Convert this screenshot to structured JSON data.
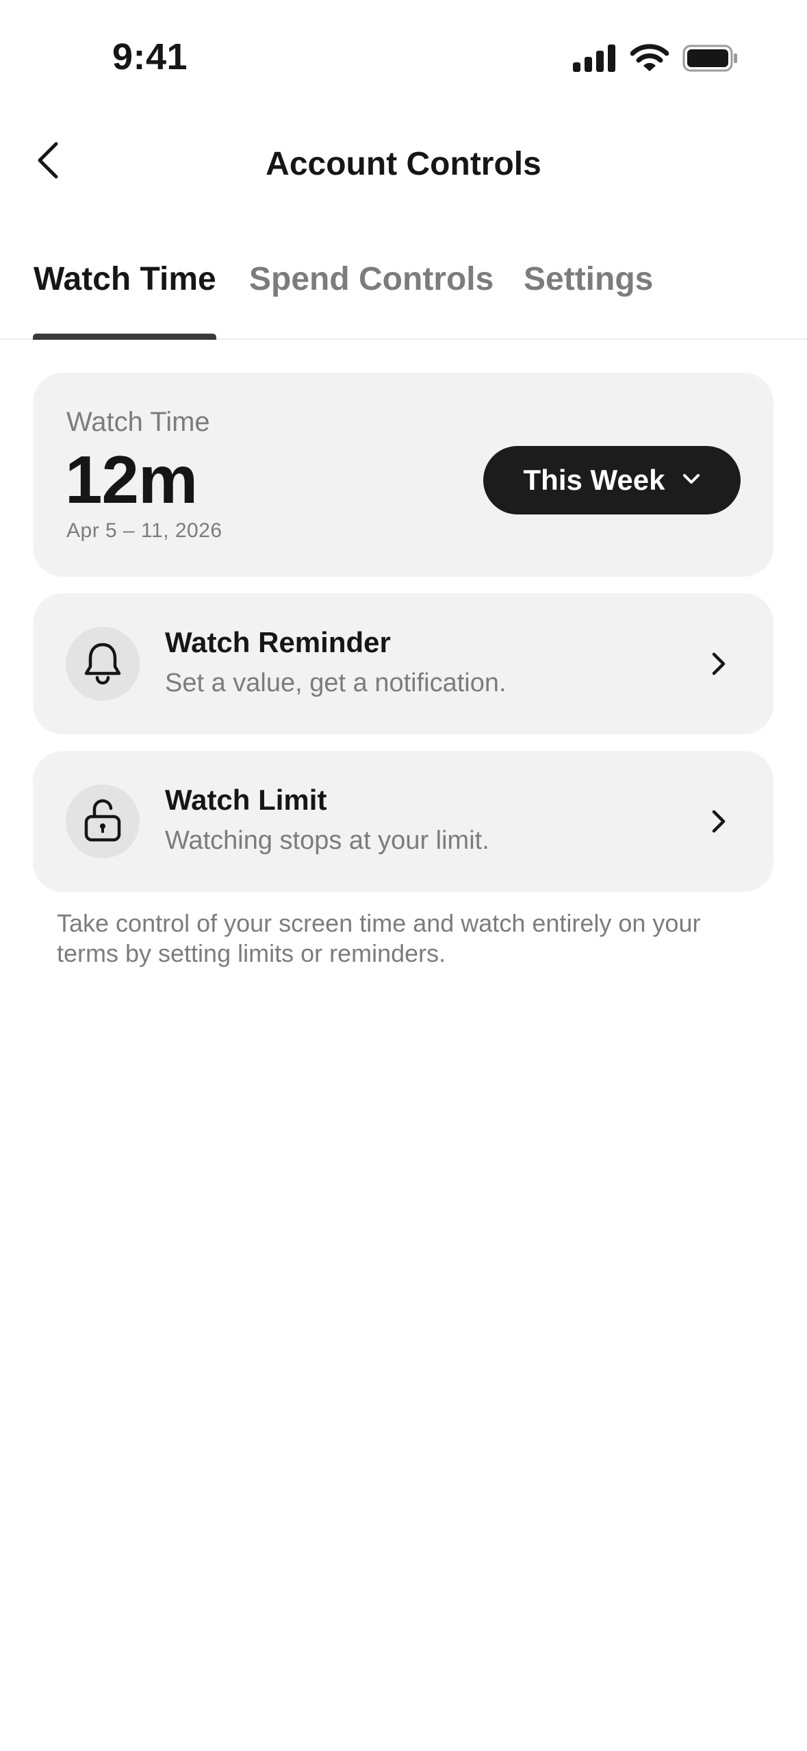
{
  "status_bar": {
    "time": "9:41",
    "icons": [
      "cellular-signal-icon",
      "wifi-icon",
      "battery-icon"
    ]
  },
  "header": {
    "title": "Account Controls",
    "back_icon": "chevron-left-icon"
  },
  "tabs": [
    {
      "label": "Watch Time",
      "active": true
    },
    {
      "label": "Spend Controls",
      "active": false
    },
    {
      "label": "Settings",
      "active": false
    }
  ],
  "summary": {
    "label": "Watch Time",
    "value": "12m",
    "range": "Apr 5 – 11, 2026",
    "period_selector": {
      "selected": "This Week",
      "icon": "chevron-down-icon"
    }
  },
  "rows": [
    {
      "title": "Watch Reminder",
      "subtitle": "Set a value, get a notification.",
      "icon": "bell-icon"
    },
    {
      "title": "Watch Limit",
      "subtitle": "Watching stops at your limit.",
      "icon": "lock-icon"
    }
  ],
  "footnote": "Take control of your screen time and watch entirely on your terms by setting limits or reminders.",
  "colors": {
    "text_primary": "#161616",
    "text_secondary": "#7c7c7c",
    "card_background": "#f2f2f2",
    "icon_circle": "#e3e3e3",
    "button_dark": "#1c1c1c",
    "tab_indicator": "#3a3a3a"
  }
}
